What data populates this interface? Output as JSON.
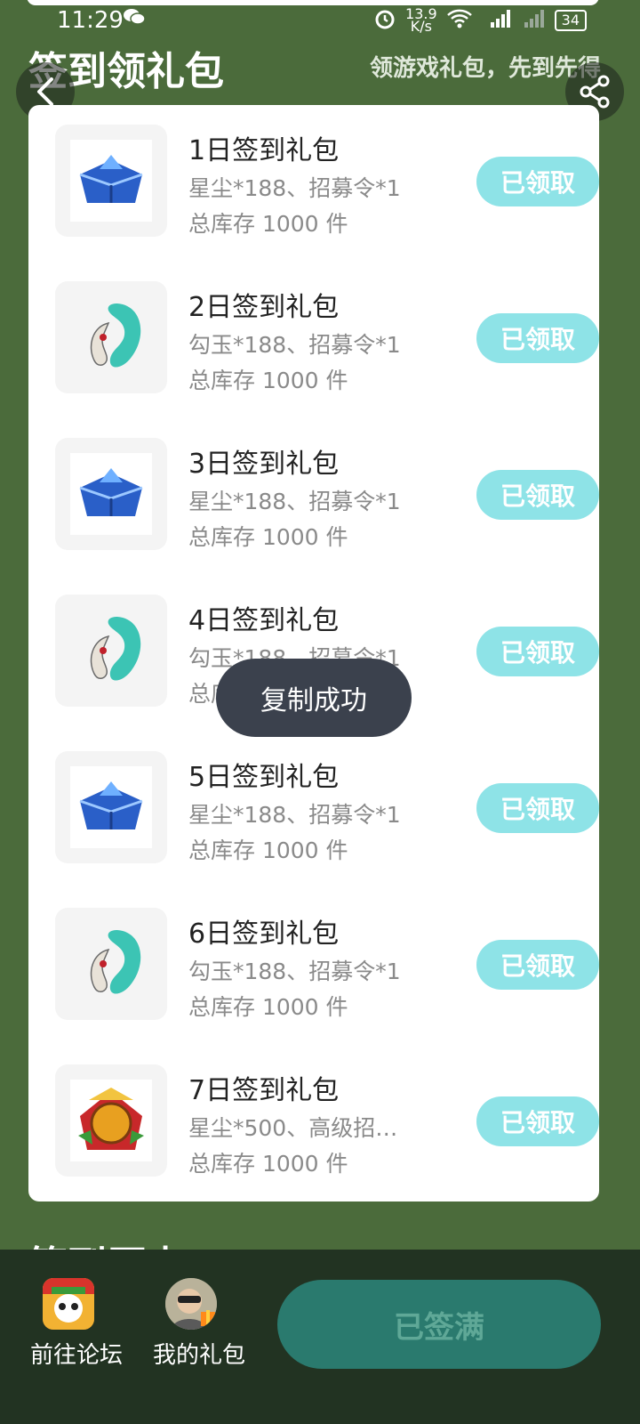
{
  "status_bar": {
    "time": "11:29",
    "speed_value": "13.9",
    "speed_unit": "K/s",
    "battery": "34"
  },
  "header": {
    "title": "签到领礼包",
    "subtitle": "领游戏礼包，先到先得"
  },
  "gifts": [
    {
      "title": "1日签到礼包",
      "desc": "星尘*188、招募令*1",
      "stock": "总库存 1000 件",
      "button": "已领取",
      "icon": "blue-chest-icon"
    },
    {
      "title": "2日签到礼包",
      "desc": "勾玉*188、招募令*1",
      "stock": "总库存 1000 件",
      "button": "已领取",
      "icon": "jade-magatama-icon"
    },
    {
      "title": "3日签到礼包",
      "desc": "星尘*188、招募令*1",
      "stock": "总库存 1000 件",
      "button": "已领取",
      "icon": "blue-chest-icon"
    },
    {
      "title": "4日签到礼包",
      "desc": "勾玉*188、招募令*1",
      "stock": "总库存 1000 件",
      "button": "已领取",
      "icon": "jade-magatama-icon"
    },
    {
      "title": "5日签到礼包",
      "desc": "星尘*188、招募令*1",
      "stock": "总库存 1000 件",
      "button": "已领取",
      "icon": "blue-chest-icon"
    },
    {
      "title": "6日签到礼包",
      "desc": "勾玉*188、招募令*1",
      "stock": "总库存 1000 件",
      "button": "已领取",
      "icon": "jade-magatama-icon"
    },
    {
      "title": "7日签到礼包",
      "desc": "星尘*500、高级招…",
      "stock": "总库存 1000 件",
      "button": "已领取",
      "icon": "recruit-token-icon"
    }
  ],
  "toast": "复制成功",
  "history_title": "签到历史",
  "bottom_bar": {
    "forum_label": "前往论坛",
    "my_gifts_label": "我的礼包",
    "signed_button": "已签满"
  },
  "colors": {
    "background": "#4b6b3b",
    "claim_button": "#8ee3e7",
    "signed_button": "#2a7a6e",
    "bottom_bar": "#223322"
  }
}
